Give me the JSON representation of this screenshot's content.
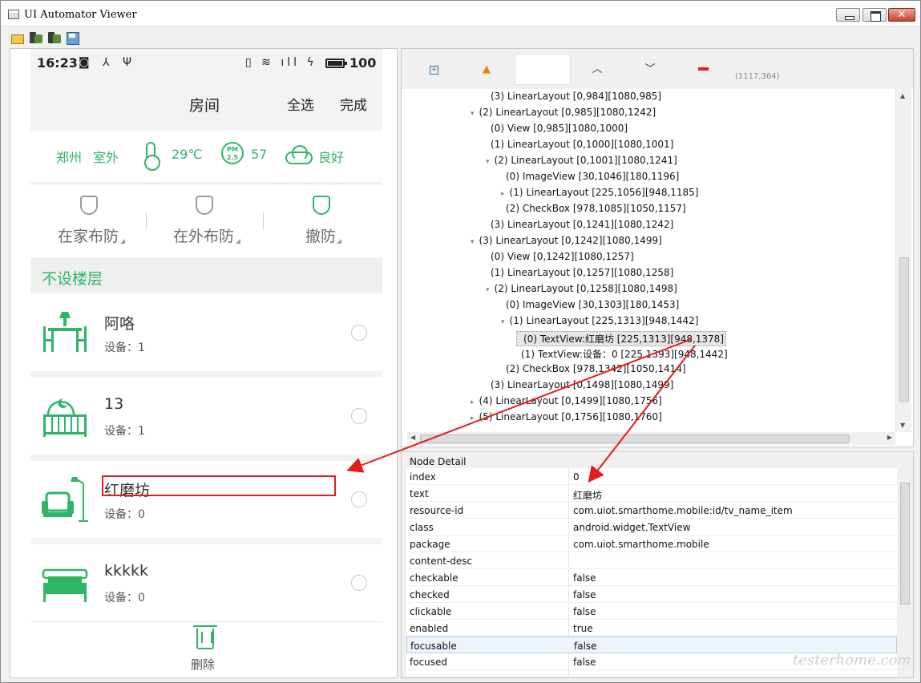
{
  "window": {
    "title": "UI Automator Viewer",
    "close_glyph": "✕"
  },
  "toolbar_icons": [
    "folder-open-icon",
    "device-screenshot-icon",
    "device-screenshot-compressed-icon",
    "save-icon"
  ],
  "phone": {
    "status": {
      "time": "16:23",
      "left_icons": "◙ ⅄ Ψ",
      "right_icons": "▯ ≋ ıll ϟ",
      "battery": "100"
    },
    "header": {
      "title": "房间",
      "select_all": "全选",
      "done": "完成"
    },
    "weather": {
      "city": "郑州",
      "outdoor": "室外",
      "temperature": "29℃",
      "pm_label": "PM\n2.5",
      "pm_value": "57",
      "air_quality": "良好"
    },
    "modes": [
      {
        "label": "在家布防"
      },
      {
        "label": "在外布防"
      },
      {
        "label": "撤防"
      }
    ],
    "floor": "不设楼层",
    "rooms": [
      {
        "name": "阿咯",
        "count": "设备：1"
      },
      {
        "name": "13",
        "count": "设备：1"
      },
      {
        "name": "红磨坊",
        "count": "设备：0"
      },
      {
        "name": "kkkkk",
        "count": "设备：0"
      }
    ],
    "delete_label": "删除",
    "accent": "#2db665"
  },
  "inspector": {
    "coords": "(1117,364)",
    "tree": [
      {
        "text": "(3) LinearLayout [0,984][1080,985]",
        "level": 4,
        "twisty": ""
      },
      {
        "text": "(2) LinearLayout [0,985][1080,1242]",
        "level": 3,
        "twisty": "▾"
      },
      {
        "text": "(0) View [0,985][1080,1000]",
        "level": 4,
        "twisty": ""
      },
      {
        "text": "(1) LinearLayout [0,1000][1080,1001]",
        "level": 4,
        "twisty": ""
      },
      {
        "text": "(2) LinearLayout [0,1001][1080,1241]",
        "level": 4,
        "twisty": "▾"
      },
      {
        "text": "(0) ImageView [30,1046][180,1196]",
        "level": 5,
        "twisty": ""
      },
      {
        "text": "(1) LinearLayout [225,1056][948,1185]",
        "level": 5,
        "twisty": "▸"
      },
      {
        "text": "(2) CheckBox [978,1085][1050,1157]",
        "level": 5,
        "twisty": ""
      },
      {
        "text": "(3) LinearLayout [0,1241][1080,1242]",
        "level": 4,
        "twisty": ""
      },
      {
        "text": "(3) LinearLayout [0,1242][1080,1499]",
        "level": 3,
        "twisty": "▾"
      },
      {
        "text": "(0) View [0,1242][1080,1257]",
        "level": 4,
        "twisty": ""
      },
      {
        "text": "(1) LinearLayout [0,1257][1080,1258]",
        "level": 4,
        "twisty": ""
      },
      {
        "text": "(2) LinearLayout [0,1258][1080,1498]",
        "level": 4,
        "twisty": "▾"
      },
      {
        "text": "(0) ImageView [30,1303][180,1453]",
        "level": 5,
        "twisty": ""
      },
      {
        "text": "(1) LinearLayout [225,1313][948,1442]",
        "level": 5,
        "twisty": "▾"
      },
      {
        "text": "(0) TextView:红磨坊 [225,1313][948,1378]",
        "level": 6,
        "twisty": "",
        "selected": true
      },
      {
        "text": "(1) TextView:设备：0 [225,1393][948,1442]",
        "level": 6,
        "twisty": ""
      },
      {
        "text": "(2) CheckBox [978,1342][1050,1414]",
        "level": 5,
        "twisty": ""
      },
      {
        "text": "(3) LinearLayout [0,1498][1080,1499]",
        "level": 4,
        "twisty": ""
      },
      {
        "text": "(4) LinearLayout [0,1499][1080,1756]",
        "level": 3,
        "twisty": "▸"
      },
      {
        "text": "(5) LinearLayout [0,1756][1080,1760]",
        "level": 3,
        "twisty": "▸"
      }
    ],
    "detail_title": "Node Detail",
    "details": [
      {
        "key": "index",
        "value": "0"
      },
      {
        "key": "text",
        "value": "红磨坊"
      },
      {
        "key": "resource-id",
        "value": "com.uiot.smarthome.mobile:id/tv_name_item"
      },
      {
        "key": "class",
        "value": "android.widget.TextView"
      },
      {
        "key": "package",
        "value": "com.uiot.smarthome.mobile"
      },
      {
        "key": "content-desc",
        "value": ""
      },
      {
        "key": "checkable",
        "value": "false"
      },
      {
        "key": "checked",
        "value": "false"
      },
      {
        "key": "clickable",
        "value": "false"
      },
      {
        "key": "enabled",
        "value": "true"
      },
      {
        "key": "focusable",
        "value": "false",
        "selected": true
      },
      {
        "key": "focused",
        "value": "false"
      }
    ]
  },
  "watermark": "testerhome.com"
}
